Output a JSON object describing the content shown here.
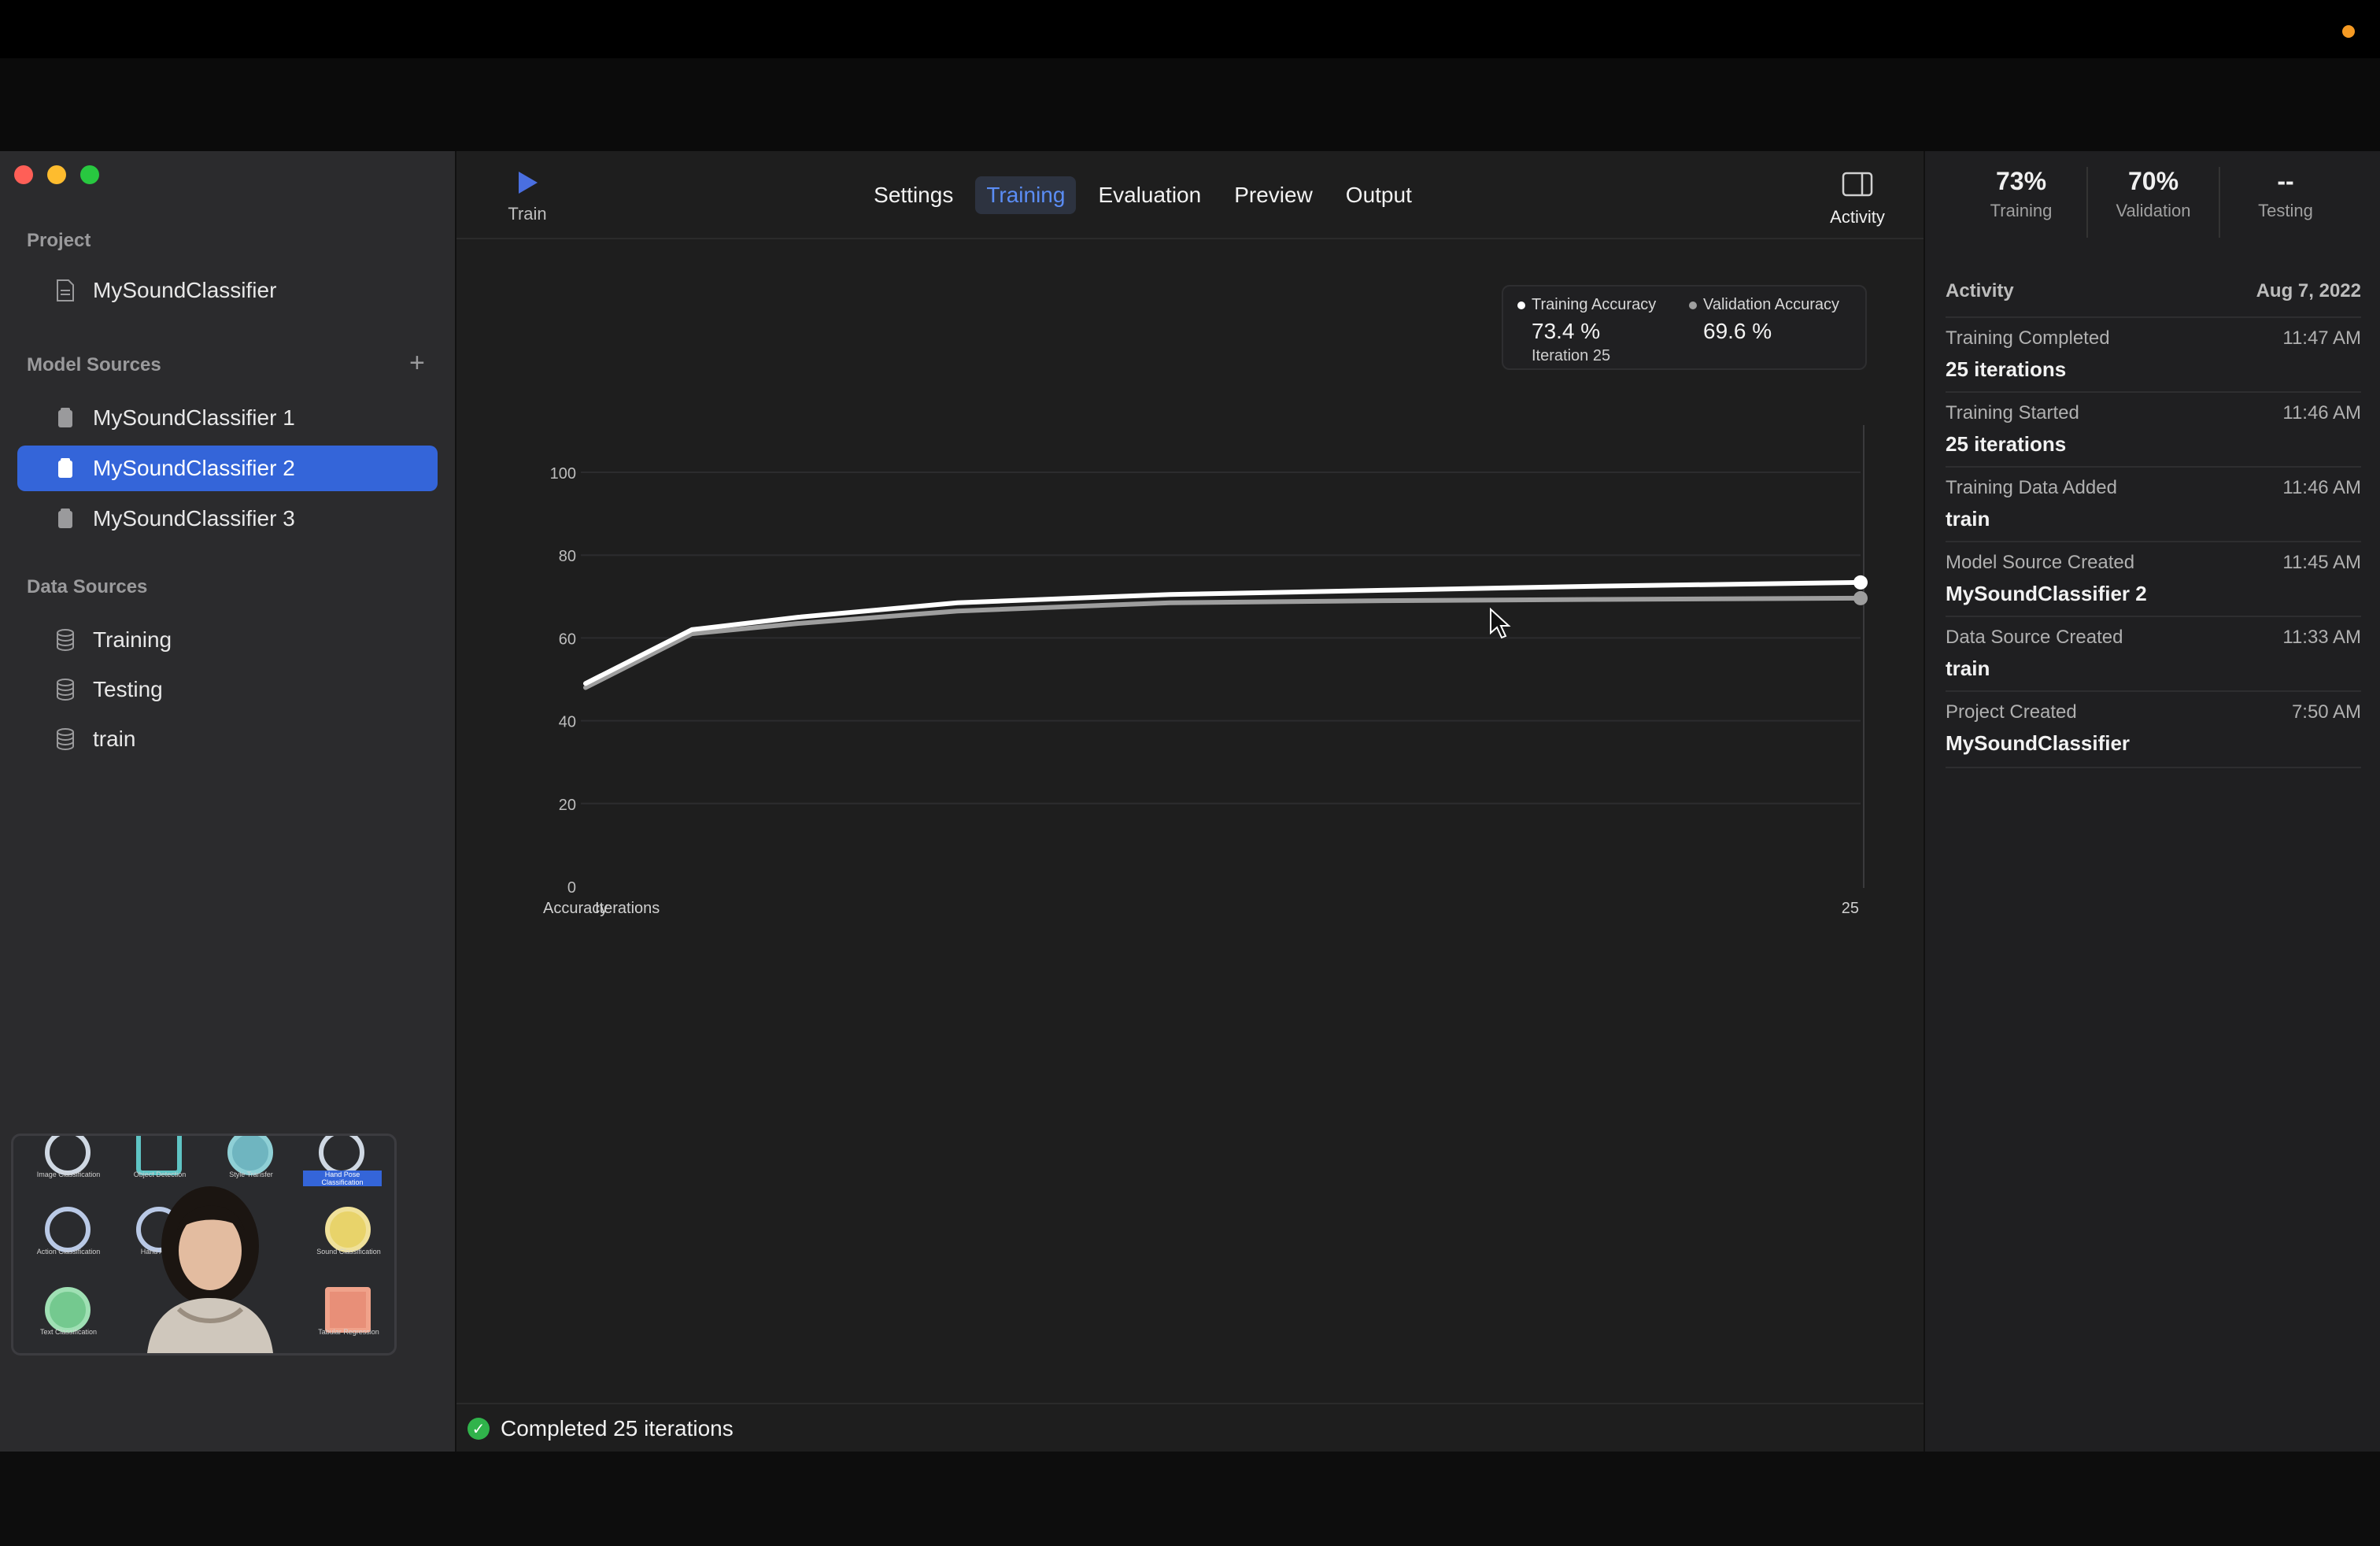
{
  "sidebar": {
    "project_label": "Project",
    "project_name": "MySoundClassifier",
    "model_sources_label": "Model Sources",
    "model_sources": [
      "MySoundClassifier 1",
      "MySoundClassifier 2",
      "MySoundClassifier 3"
    ],
    "selected_model_index": 1,
    "data_sources_label": "Data Sources",
    "data_sources": [
      "Training",
      "Testing",
      "train"
    ]
  },
  "toolbar": {
    "train_label": "Train",
    "tabs": [
      "Settings",
      "Training",
      "Evaluation",
      "Preview",
      "Output"
    ],
    "active_tab": "Training",
    "activity_label": "Activity"
  },
  "chart_data": {
    "type": "line",
    "xlabel": "Iterations",
    "ylabel": "Accuracy",
    "ylim": [
      0,
      100
    ],
    "yticks": [
      0,
      20,
      40,
      60,
      80,
      100
    ],
    "x_end_label": "25",
    "series": [
      {
        "name": "Training Accuracy",
        "x": [
          1,
          3,
          5,
          8,
          12,
          16,
          20,
          25
        ],
        "values": [
          49,
          62,
          65,
          68.5,
          70.5,
          71.5,
          72.5,
          73.4
        ]
      },
      {
        "name": "Validation Accuracy",
        "x": [
          1,
          3,
          5,
          8,
          12,
          16,
          20,
          25
        ],
        "values": [
          48,
          61,
          63.5,
          66.5,
          68.5,
          69,
          69.3,
          69.6
        ]
      }
    ],
    "tooltip": {
      "training_name": "Training Accuracy",
      "training_value": "73.4 %",
      "validation_name": "Validation Accuracy",
      "validation_value": "69.6 %",
      "iteration": "Iteration 25"
    },
    "colors": {
      "training": "#ffffff",
      "validation": "#9e9e9e"
    }
  },
  "status": {
    "text": "Completed 25 iterations"
  },
  "metrics": [
    {
      "value": "73%",
      "label": "Training"
    },
    {
      "value": "70%",
      "label": "Validation"
    },
    {
      "value": "--",
      "label": "Testing"
    }
  ],
  "activity": {
    "title": "Activity",
    "date": "Aug 7, 2022",
    "items": [
      {
        "title": "Training Completed",
        "time": "11:47 AM",
        "detail": "25 iterations"
      },
      {
        "title": "Training Started",
        "time": "11:46 AM",
        "detail": "25 iterations"
      },
      {
        "title": "Training Data Added",
        "time": "11:46 AM",
        "detail": "train"
      },
      {
        "title": "Model Source Created",
        "time": "11:45 AM",
        "detail": "MySoundClassifier 2"
      },
      {
        "title": "Data Source Created",
        "time": "11:33 AM",
        "detail": "train"
      },
      {
        "title": "Project Created",
        "time": "7:50 AM",
        "detail": "MySoundClassifier"
      }
    ]
  },
  "pip": {
    "labels": [
      "Image Classification",
      "Object Detection",
      "Style Transfer",
      "Hand Pose Classification",
      "Action Classification",
      "Hand Action",
      "Sound Classification",
      "Text Classification",
      "Tabular Regression"
    ]
  }
}
